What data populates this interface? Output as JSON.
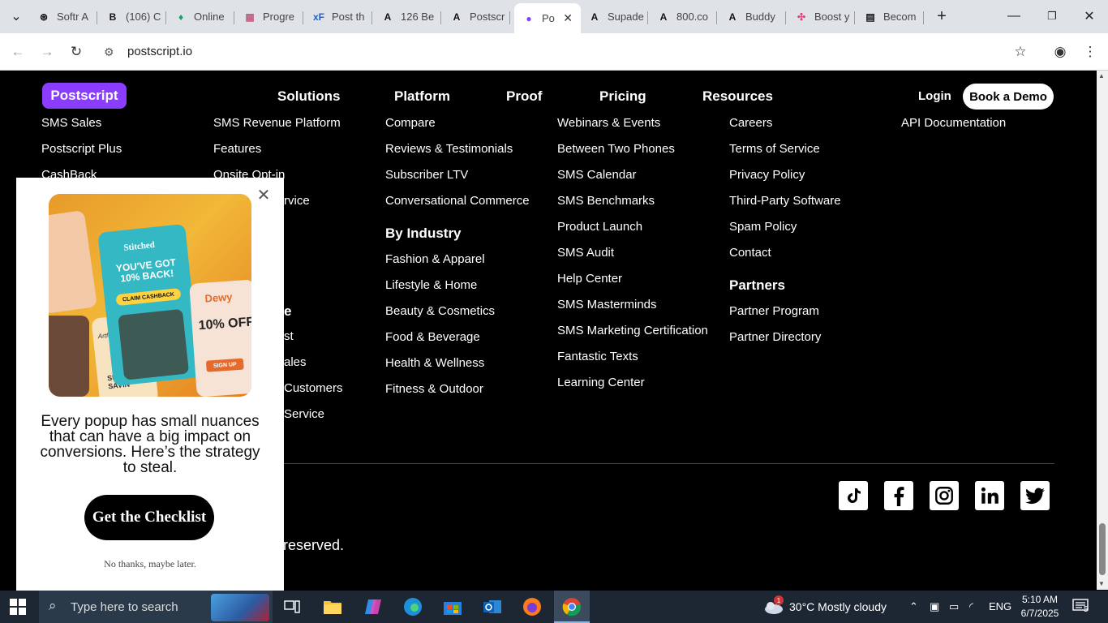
{
  "browser": {
    "tabs": [
      {
        "title": "Softr A",
        "icon": "softr-icon"
      },
      {
        "title": "(106) C",
        "icon": "b-icon"
      },
      {
        "title": "Online",
        "icon": "leaf-icon"
      },
      {
        "title": "Progre",
        "icon": "progress-icon"
      },
      {
        "title": "Post th",
        "icon": "xf-icon"
      },
      {
        "title": "126 Be",
        "icon": "a-icon"
      },
      {
        "title": "Postscr",
        "icon": "a-icon"
      },
      {
        "title": "Po",
        "icon": "postscript-icon"
      },
      {
        "title": "Supade",
        "icon": "a-icon"
      },
      {
        "title": "800.co",
        "icon": "a-icon"
      },
      {
        "title": "Buddy",
        "icon": "a-icon"
      },
      {
        "title": "Boost y",
        "icon": "pinwheel-icon"
      },
      {
        "title": "Becom",
        "icon": "doc-icon"
      }
    ],
    "new_tab_label": "+",
    "url": "postscript.io"
  },
  "site": {
    "logo_text": "Postscript",
    "nav": [
      "Solutions",
      "Platform",
      "Proof",
      "Pricing",
      "Resources"
    ],
    "login": "Login",
    "demo": "Book a Demo"
  },
  "footer": {
    "col1": [
      "SMS Sales",
      "Postscript Plus",
      "CashBack"
    ],
    "col2": [
      "SMS Revenue Platform",
      "Features",
      "Onsite Opt-in",
      "rvice"
    ],
    "col2_partial": [
      "e",
      "st",
      "ales",
      "Customers",
      "Service"
    ],
    "col3": [
      "Compare",
      "Reviews & Testimonials",
      "Subscriber LTV",
      "Conversational Commerce"
    ],
    "col3_heading": "By Industry",
    "col3_industry": [
      "Fashion & Apparel",
      "Lifestyle & Home",
      "Beauty & Cosmetics",
      "Food & Beverage",
      "Health & Wellness",
      "Fitness & Outdoor"
    ],
    "col4": [
      "Webinars & Events",
      "Between Two Phones",
      "SMS Calendar",
      "SMS Benchmarks",
      "Product Launch",
      "SMS Audit",
      "Help Center",
      "SMS Masterminds",
      "SMS Marketing Certification",
      "Fantastic Texts",
      "Learning Center"
    ],
    "col5": [
      "Careers",
      "Terms of Service",
      "Privacy Policy",
      "Third-Party Software",
      "Spam Policy",
      "Contact"
    ],
    "col5_heading": "Partners",
    "col5_partners": [
      "Partner Program",
      "Partner Directory"
    ],
    "col6": [
      "API Documentation"
    ],
    "copyright_fragment": "reserved.",
    "social": [
      "tiktok-icon",
      "facebook-icon",
      "instagram-icon",
      "linkedin-icon",
      "twitter-icon"
    ]
  },
  "popup": {
    "image_texts": {
      "brand": "Stitched",
      "headline": "YOU'VE GOT 10% BACK!",
      "button": "CLAIM CASHBACK",
      "brand2": "Dewy",
      "offer2": "10% OFF",
      "sign": "SIGN UP",
      "studio": "ArtfulStudio",
      "summer": "SUMMER SAVIN"
    },
    "message": "Every popup has small nuances that can have a big impact on conversions. Here’s the strategy to steal.",
    "cta": "Get the Checklist",
    "dismiss": "No thanks, maybe later."
  },
  "taskbar": {
    "search_placeholder": "Type here to search",
    "weather": "30°C  Mostly cloudy",
    "weather_badge": "1",
    "lang": "ENG",
    "time": "5:10 AM",
    "date": "6/7/2025",
    "notif_count": "5"
  }
}
